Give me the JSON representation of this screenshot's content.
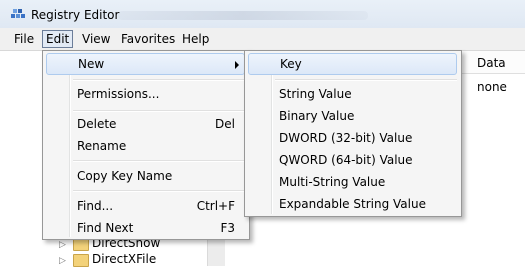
{
  "window": {
    "title": "Registry Editor",
    "icon": "registry-editor-icon"
  },
  "menubar": {
    "items": [
      {
        "label": "File"
      },
      {
        "label": "Edit"
      },
      {
        "label": "View"
      },
      {
        "label": "Favorites"
      },
      {
        "label": "Help"
      }
    ]
  },
  "edit_menu": {
    "items": [
      {
        "label": "New",
        "accel": ""
      },
      {
        "label": "Permissions...",
        "accel": ""
      },
      {
        "label": "Delete",
        "accel": "Del"
      },
      {
        "label": "Rename",
        "accel": ""
      },
      {
        "label": "Copy Key Name",
        "accel": ""
      },
      {
        "label": "Find...",
        "accel": "Ctrl+F"
      },
      {
        "label": "Find Next",
        "accel": "F3"
      }
    ]
  },
  "new_submenu": {
    "items": [
      {
        "label": "Key"
      },
      {
        "label": "String Value"
      },
      {
        "label": "Binary Value"
      },
      {
        "label": "DWORD (32-bit) Value"
      },
      {
        "label": "QWORD (64-bit) Value"
      },
      {
        "label": "Multi-String Value"
      },
      {
        "label": "Expandable String Value"
      }
    ]
  },
  "values_pane": {
    "column_header": "Data",
    "cell": "none"
  },
  "tree": {
    "items": [
      {
        "label": "DirectShow"
      },
      {
        "label": "DirectXFile"
      }
    ]
  },
  "colors": {
    "highlight_border": "#aecbee",
    "menu_background": "#f5f5f5"
  }
}
